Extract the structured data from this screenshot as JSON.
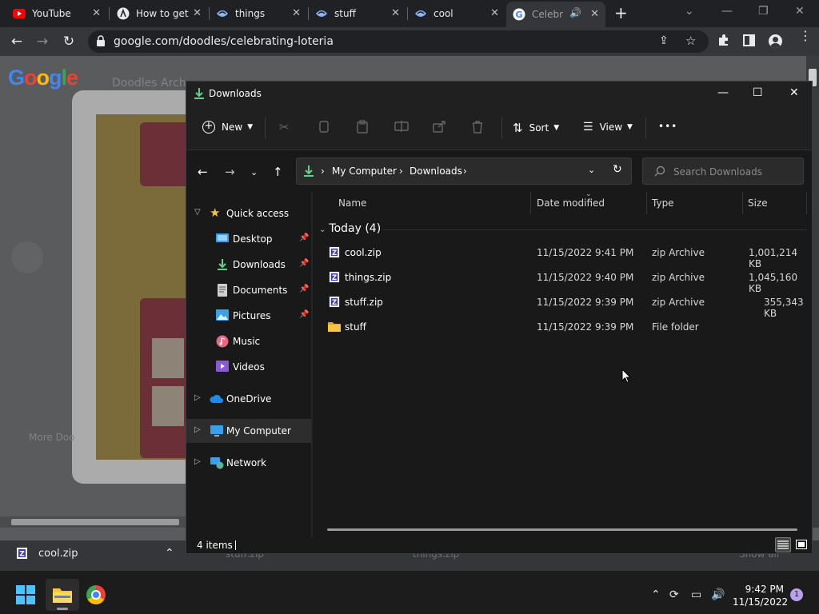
{
  "browser": {
    "tabs": [
      {
        "title": "YouTube",
        "icon": "youtube-icon"
      },
      {
        "title": "How to get",
        "icon": "tab-favicon"
      },
      {
        "title": "things",
        "icon": "tab-favicon"
      },
      {
        "title": "stuff",
        "icon": "tab-favicon"
      },
      {
        "title": "cool",
        "icon": "tab-favicon"
      },
      {
        "title": "Celebr",
        "icon": "google-icon"
      }
    ],
    "new_tab_label": "+",
    "url": "google.com/doodles/celebrating-loteria",
    "page": {
      "logo_letters": [
        "G",
        "o",
        "o",
        "g",
        "l",
        "e"
      ],
      "logo_colors": [
        "#4285f4",
        "#ea4335",
        "#fbbc05",
        "#4285f4",
        "#34a853",
        "#ea4335"
      ],
      "doodles_archive_label": "Doodles Arch",
      "more_doodles_label": "More Doo"
    },
    "download_bar": {
      "file": "cool.zip",
      "other_files": [
        "stuff.zip",
        "things.zip"
      ],
      "show_all": "Show all"
    }
  },
  "explorer": {
    "title": "Downloads",
    "commands": {
      "new": "New",
      "sort": "Sort",
      "view": "View",
      "more": "•••"
    },
    "breadcrumb": [
      "My Computer",
      "Downloads"
    ],
    "search_placeholder": "Search Downloads",
    "nav": {
      "quick_access": "Quick access",
      "pinned": [
        {
          "label": "Desktop",
          "icon": "desktop-icon",
          "pinned": true
        },
        {
          "label": "Downloads",
          "icon": "downloads-icon",
          "pinned": true
        },
        {
          "label": "Documents",
          "icon": "documents-icon",
          "pinned": true
        },
        {
          "label": "Pictures",
          "icon": "pictures-icon",
          "pinned": true
        },
        {
          "label": "Music",
          "icon": "music-icon",
          "pinned": false
        },
        {
          "label": "Videos",
          "icon": "videos-icon",
          "pinned": false
        }
      ],
      "onedrive": "OneDrive",
      "my_computer": "My Computer",
      "network": "Network"
    },
    "columns": {
      "name": "Name",
      "date_modified": "Date modified",
      "type": "Type",
      "size": "Size"
    },
    "group": "Today (4)",
    "files": [
      {
        "name": "cool.zip",
        "date": "11/15/2022 9:41 PM",
        "type": "zip Archive",
        "size": "1,001,214 KB",
        "icon": "zip-archive-icon"
      },
      {
        "name": "things.zip",
        "date": "11/15/2022 9:40 PM",
        "type": "zip Archive",
        "size": "1,045,160 KB",
        "icon": "zip-archive-icon"
      },
      {
        "name": "stuff.zip",
        "date": "11/15/2022 9:39 PM",
        "type": "zip Archive",
        "size": "355,343 KB",
        "icon": "zip-archive-icon"
      },
      {
        "name": "stuff",
        "date": "11/15/2022 9:39 PM",
        "type": "File folder",
        "size": "",
        "icon": "folder-icon"
      }
    ],
    "status": "4 items"
  },
  "taskbar": {
    "time": "9:42 PM",
    "date": "11/15/2022",
    "notification_count": "1"
  },
  "colors": {
    "accent": "#60cdff",
    "folder": "#f4c542",
    "selection": "#2d2d2d"
  }
}
